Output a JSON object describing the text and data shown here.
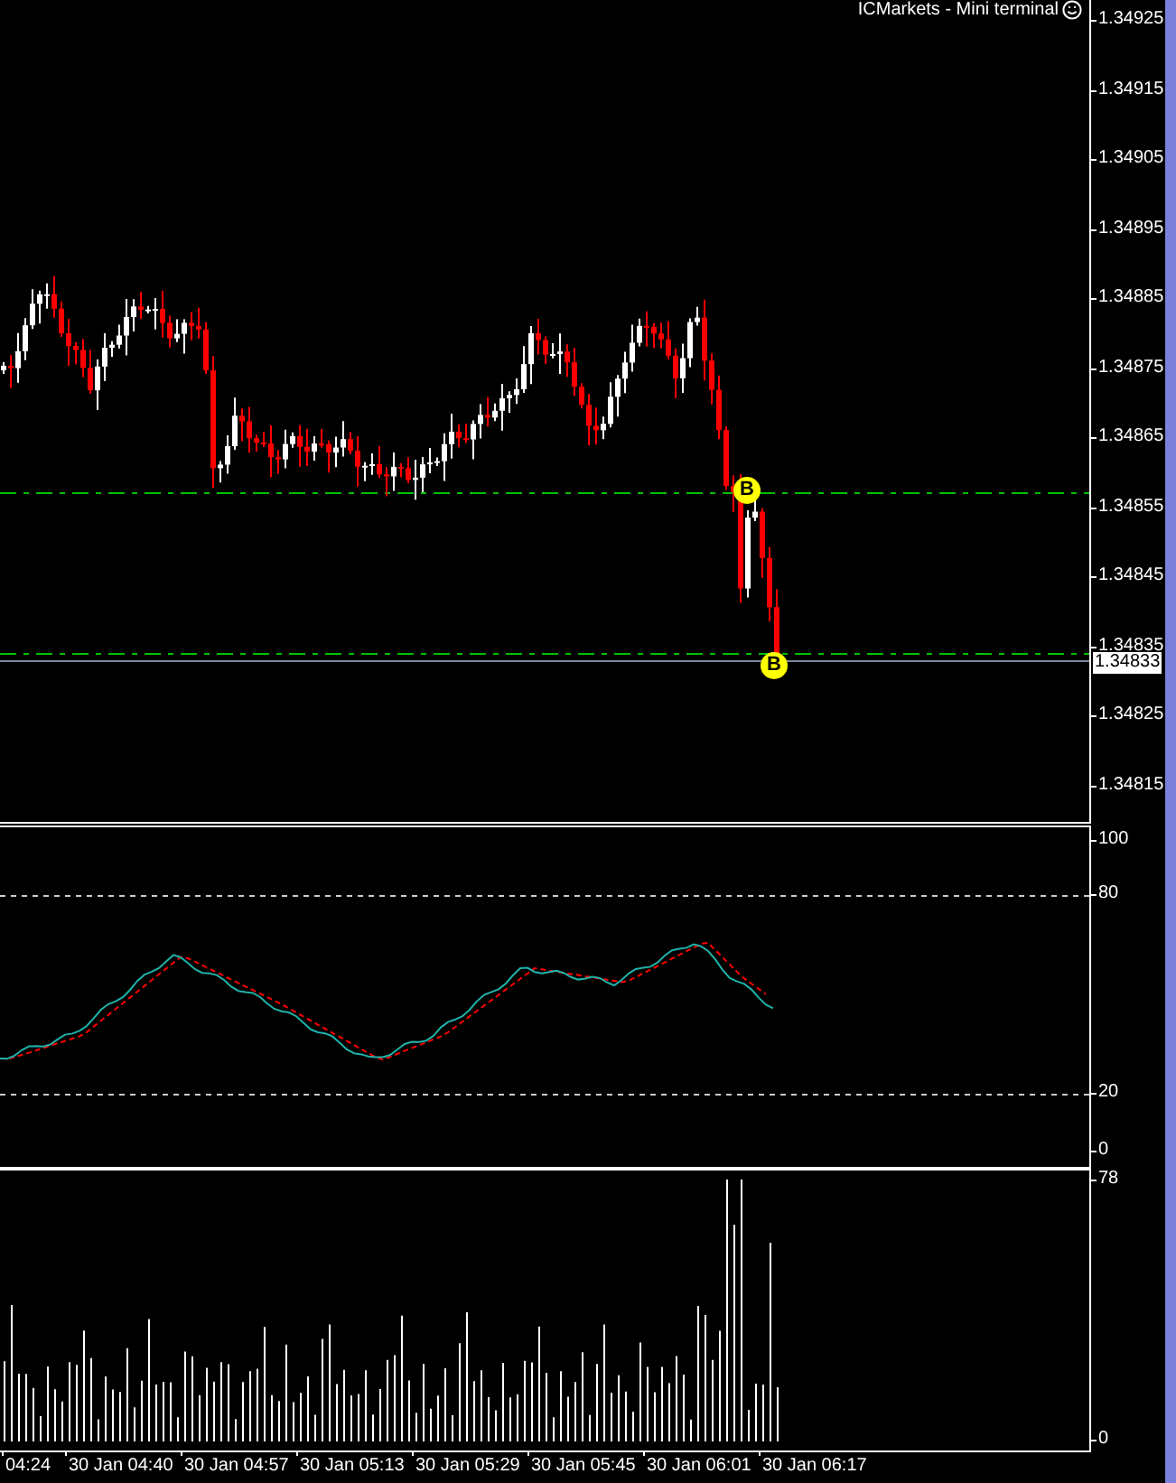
{
  "window": {
    "title": "ICMarkets - Mini terminal"
  },
  "price_chart": {
    "price_axis": [
      "1.34925",
      "1.34915",
      "1.34905",
      "1.34895",
      "1.34885",
      "1.34875",
      "1.34865",
      "1.34855",
      "1.34845",
      "1.34835",
      "1.34825",
      "1.34815"
    ],
    "current_price": "1.34833",
    "trade_markers": [
      {
        "label": "B"
      },
      {
        "label": "B"
      }
    ]
  },
  "oscillator": {
    "axis": [
      "100",
      "80",
      "20",
      "0"
    ]
  },
  "volume": {
    "axis": [
      "78",
      "0"
    ]
  },
  "time_axis": [
    "04:24",
    "30 Jan 04:40",
    "30 Jan 04:57",
    "30 Jan 05:13",
    "30 Jan 05:29",
    "30 Jan 05:45",
    "30 Jan 06:01",
    "30 Jan 06:17"
  ]
}
